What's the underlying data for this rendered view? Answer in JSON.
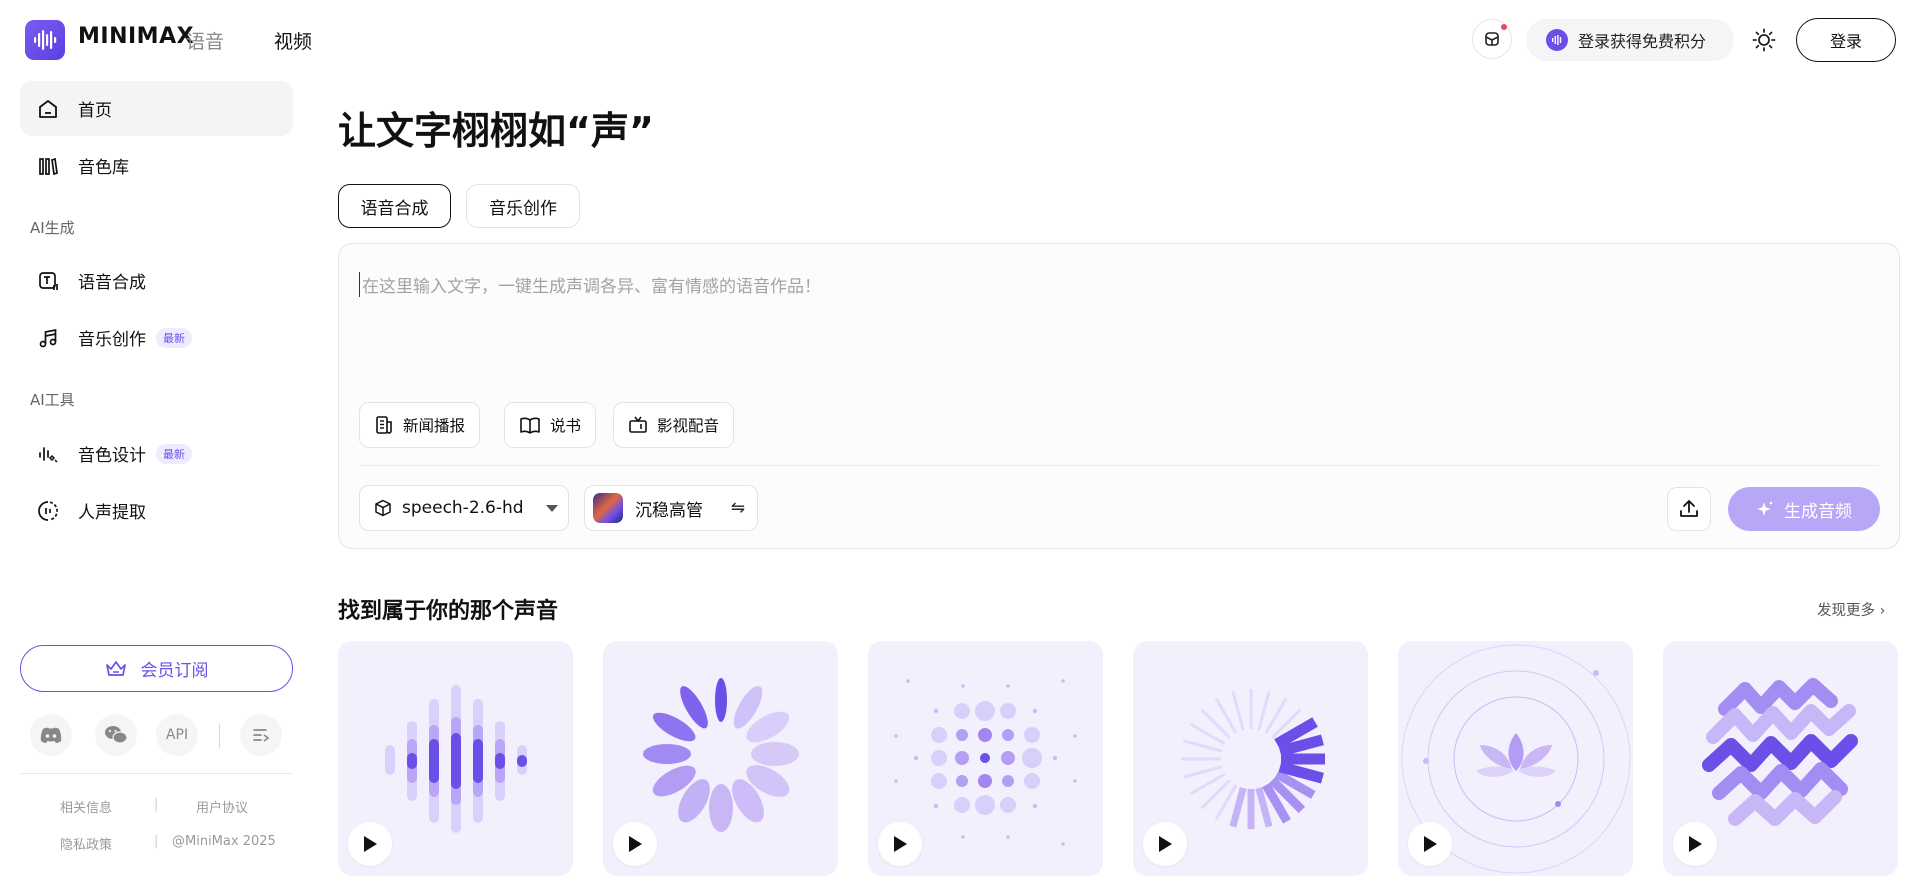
{
  "header": {
    "logo_text": "MINIMAX",
    "nav": {
      "voice": "语音",
      "video": "视频"
    },
    "credits_label": "登录获得免费积分",
    "login_label": "登录"
  },
  "sidebar": {
    "items": [
      {
        "label": "首页",
        "icon": "home-icon",
        "active": true
      },
      {
        "label": "音色库",
        "icon": "library-icon"
      }
    ],
    "section_ai_gen": "AI生成",
    "gen_items": [
      {
        "label": "语音合成",
        "icon": "tts-icon"
      },
      {
        "label": "音乐创作",
        "icon": "music-note-icon",
        "badge": "最新"
      }
    ],
    "section_ai_tools": "AI工具",
    "tool_items": [
      {
        "label": "音色设计",
        "icon": "voice-design-icon",
        "badge": "最新"
      },
      {
        "label": "人声提取",
        "icon": "vocal-extract-icon"
      }
    ],
    "member_label": "会员订阅",
    "social": {
      "api_label": "API"
    },
    "footer": {
      "related": "相关信息",
      "agreement": "用户协议",
      "privacy": "隐私政策",
      "copyright": "@MiniMax 2025"
    }
  },
  "main": {
    "title": "让文字栩栩如“声”",
    "tabs": [
      {
        "label": "语音合成",
        "active": true
      },
      {
        "label": "音乐创作",
        "active": false
      }
    ],
    "editor": {
      "placeholder": "在这里输入文字，一键生成声调各异、富有情感的语音作品！",
      "chips": [
        "新闻播报",
        "说书",
        "影视配音"
      ],
      "model": "speech-2.6-hd",
      "voice": "沉稳高管",
      "generate_label": "生成音频"
    },
    "voices_section": {
      "title": "找到属于你的那个声音",
      "more_label": "发现更多 ›"
    }
  },
  "colors": {
    "accent": "#6b4fe8",
    "accent_light": "#b8a6f7",
    "card_bg": "#f3f0fd"
  }
}
